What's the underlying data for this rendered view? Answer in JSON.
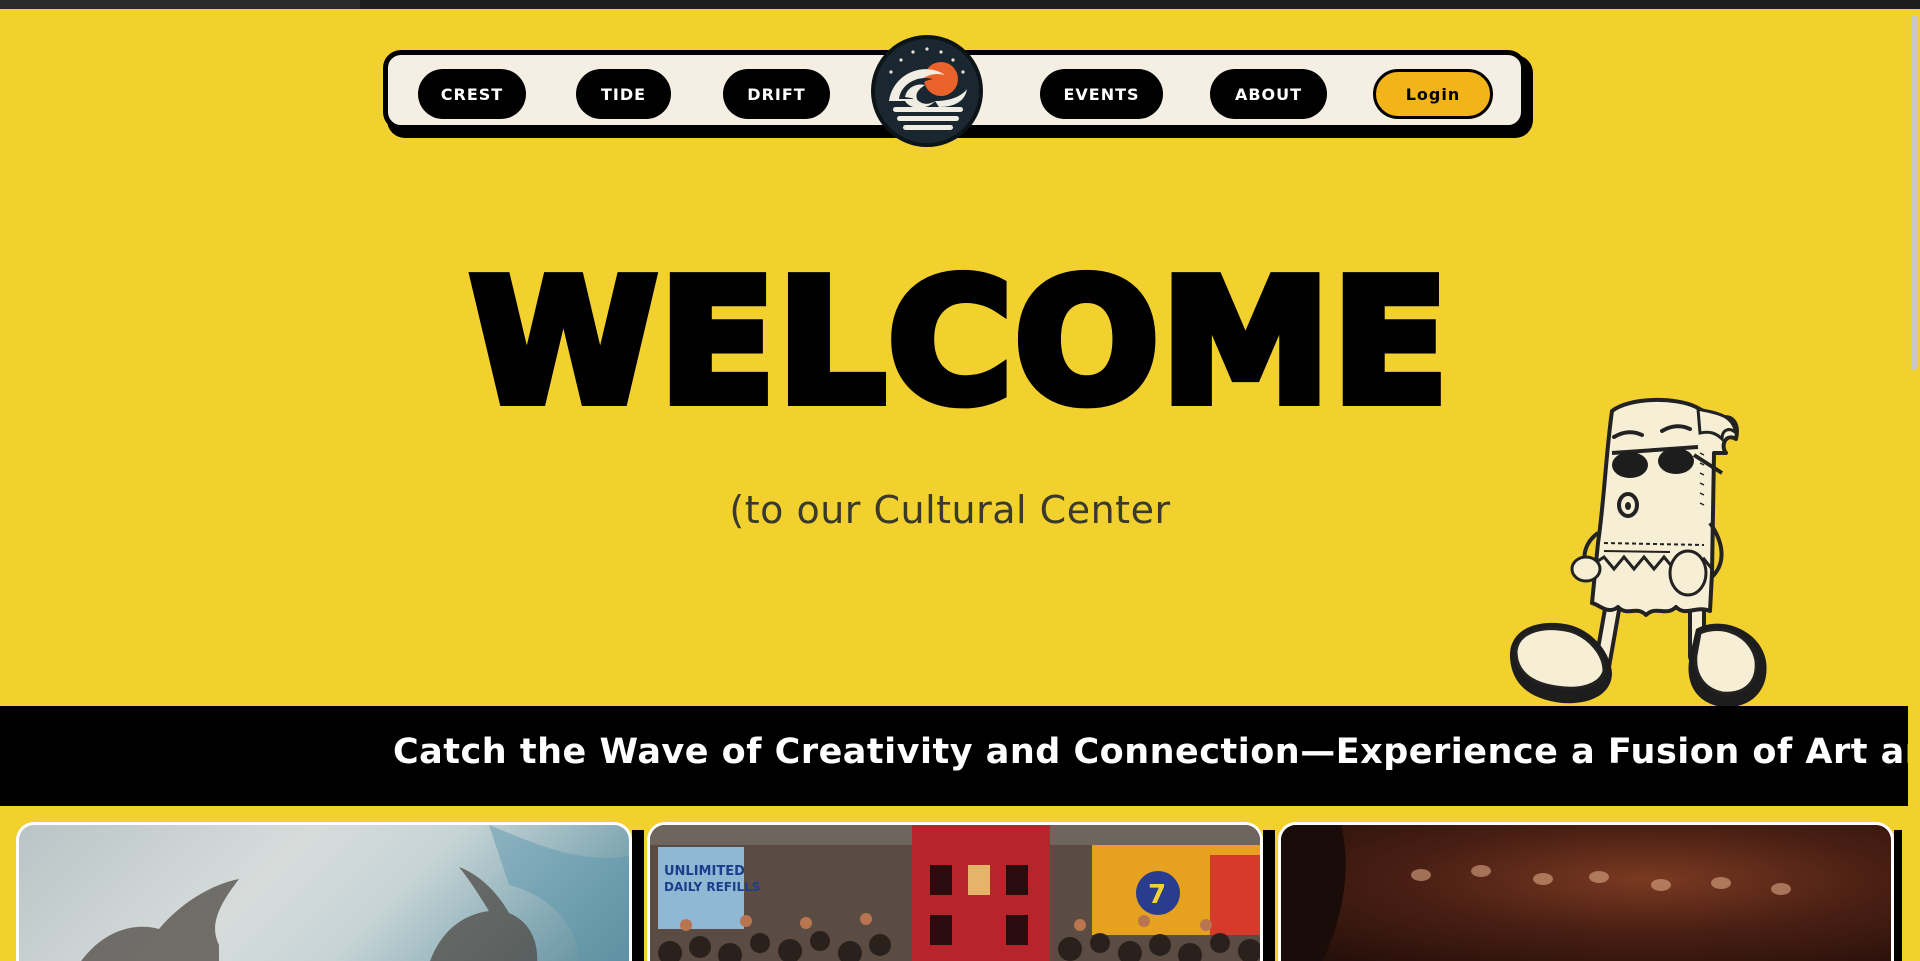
{
  "nav": {
    "left_items": [
      "CREST",
      "TIDE",
      "DRIFT"
    ],
    "right_items": [
      "EVENTS",
      "ABOUT"
    ],
    "login_label": "Login"
  },
  "hero": {
    "title": "WELCOME",
    "subtitle": "(to our Cultural Center"
  },
  "banner": {
    "text": "Catch the Wave of Creativity and Connection—Experience a Fusion of Art and Com"
  },
  "cards": [
    {
      "image": "hands-reaching-photo"
    },
    {
      "image": "crowd-convention-photo"
    },
    {
      "image": "audience-theater-photo"
    }
  ],
  "colors": {
    "background": "#f2d12e",
    "nav_bg": "#f4efe2",
    "login": "#f2b419",
    "banner": "#000000"
  }
}
